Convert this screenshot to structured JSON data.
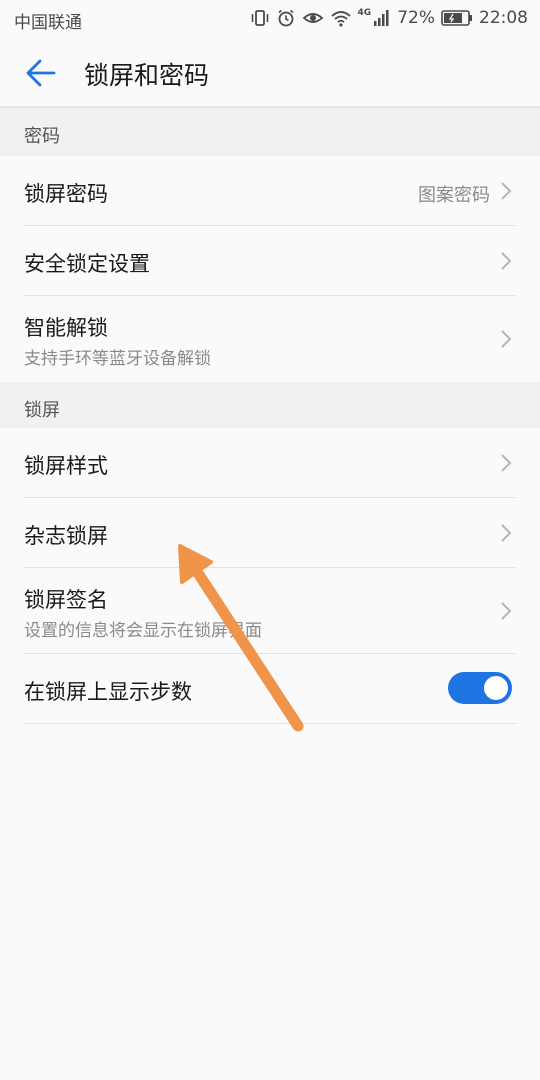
{
  "status_bar": {
    "carrier": "中国联通",
    "network": "4G",
    "battery": "72%",
    "time": "22:08"
  },
  "app_bar": {
    "title": "锁屏和密码",
    "back_icon": "back-arrow-icon"
  },
  "sections": [
    {
      "header": "密码",
      "items": [
        {
          "title": "锁屏密码",
          "value": "图案密码"
        },
        {
          "title": "安全锁定设置"
        },
        {
          "title": "智能解锁",
          "subtitle": "支持手环等蓝牙设备解锁"
        }
      ]
    },
    {
      "header": "锁屏",
      "items": [
        {
          "title": "锁屏样式"
        },
        {
          "title": "杂志锁屏"
        },
        {
          "title": "锁屏签名",
          "subtitle": "设置的信息将会显示在锁屏界面"
        },
        {
          "title": "在锁屏上显示步数",
          "toggle_on": true
        }
      ]
    }
  ],
  "colors": {
    "accent": "#1e74e0",
    "annotation_arrow": "#f0944a"
  }
}
